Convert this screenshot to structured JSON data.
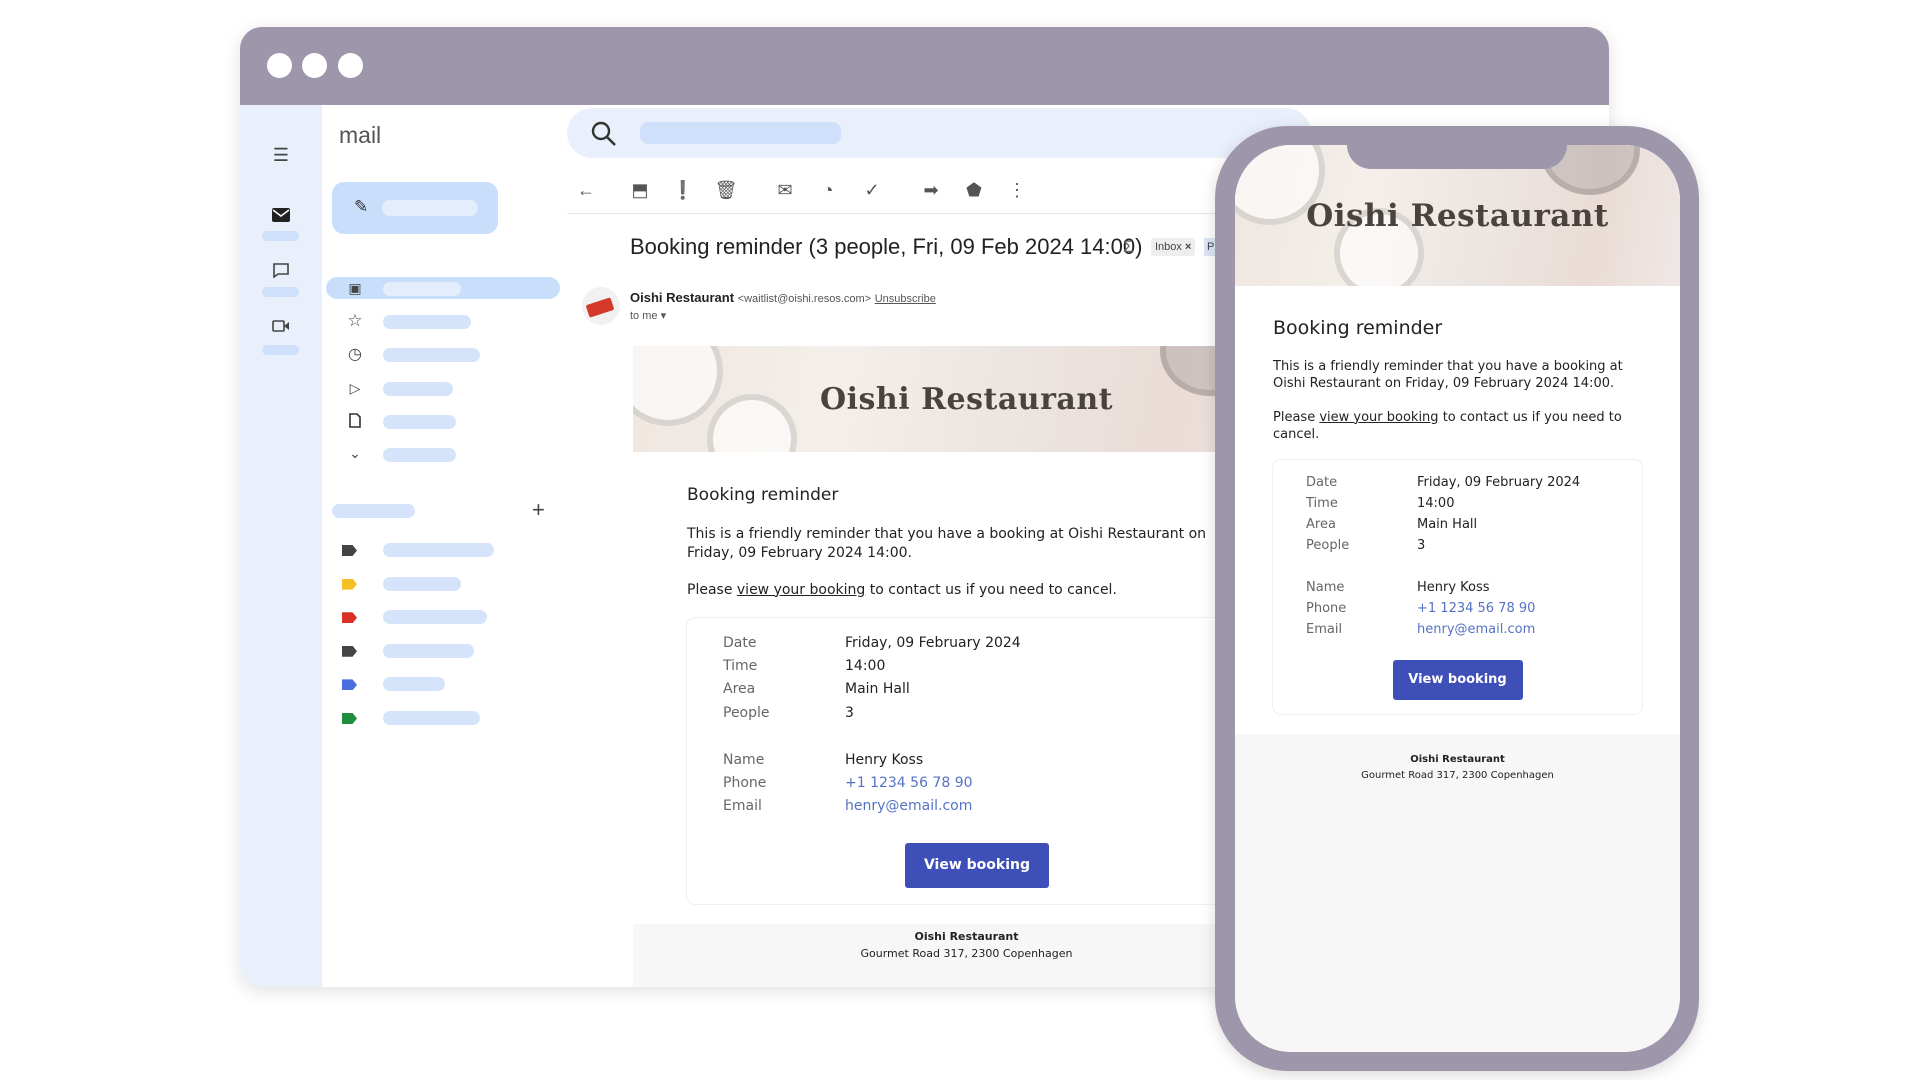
{
  "app": {
    "logo": "mail"
  },
  "rail": {
    "icons": [
      "menu-icon",
      "mail-icon",
      "chat-icon",
      "video-icon"
    ]
  },
  "sidebar": {
    "label_colors": [
      "#444444",
      "#f6bf26",
      "#d93025",
      "#444444",
      "#4a6ee0",
      "#1e8e3e"
    ]
  },
  "toolbar": {
    "icons": [
      "back-arrow-icon",
      "archive-icon",
      "report-spam-icon",
      "delete-icon",
      "mark-unread-icon",
      "snooze-icon",
      "add-task-icon",
      "move-to-icon",
      "label-icon",
      "more-icon"
    ]
  },
  "message": {
    "subject": "Booking reminder (3 people, Fri, 09 Feb 2024 14:00)",
    "chip_inbox": "Inbox",
    "chip_close": "×",
    "chip_next": "P",
    "sender_name": "Oishi Restaurant",
    "sender_email": "<waitlist@oishi.resos.com>",
    "unsubscribe": "Unsubscribe",
    "to": "to me"
  },
  "email": {
    "brand": "Oishi Restaurant",
    "heading": "Booking reminder",
    "intro": "This is a friendly reminder that you have a booking at Oishi Restaurant on Friday, 09 February 2024 14:00.",
    "cancel_pre": "Please ",
    "cancel_link": "view your booking",
    "cancel_post": " to contact us if you need to cancel.",
    "details": [
      {
        "label": "Date",
        "value": "Friday, 09 February 2024"
      },
      {
        "label": "Time",
        "value": "14:00"
      },
      {
        "label": "Area",
        "value": "Main Hall"
      },
      {
        "label": "People",
        "value": "3"
      }
    ],
    "contact": [
      {
        "label": "Name",
        "value": "Henry Koss"
      },
      {
        "label": "Phone",
        "value": "+1 1234 56 78 90"
      },
      {
        "label": "Email",
        "value": "henry@email.com"
      }
    ],
    "button": "View booking",
    "footer_name": "Oishi Restaurant",
    "footer_address": "Gourmet Road 317, 2300 Copenhagen"
  },
  "colors": {
    "frame": "#9e97ac",
    "accent": "#3f4fb8",
    "link": "#5572c4"
  }
}
